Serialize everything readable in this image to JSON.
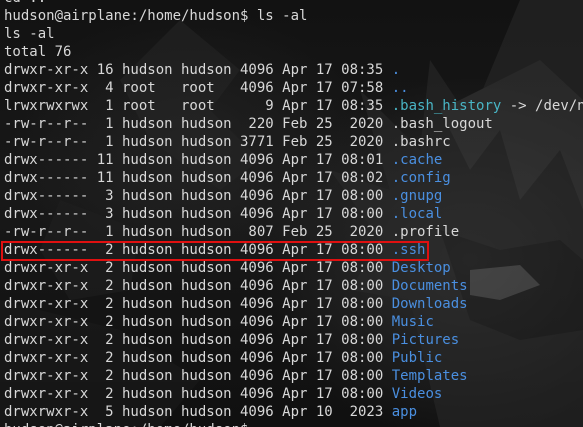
{
  "terminal": {
    "lines": [
      {
        "segments": [
          {
            "text": "cd ..",
            "style": "plain"
          }
        ]
      },
      {
        "segments": [
          {
            "text": "hudson@airplane:/home/hudson$ ls -al",
            "style": "plain"
          }
        ]
      },
      {
        "segments": [
          {
            "text": "ls -al",
            "style": "plain"
          }
        ]
      },
      {
        "segments": [
          {
            "text": "total 76",
            "style": "plain"
          }
        ]
      },
      {
        "segments": [
          {
            "text": "drwxr-xr-x 16 hudson hudson 4096 Apr 17 08:35 ",
            "style": "plain"
          },
          {
            "text": ".",
            "style": "dir"
          }
        ]
      },
      {
        "segments": [
          {
            "text": "drwxr-xr-x  4 root   root   4096 Apr 17 07:58 ",
            "style": "plain"
          },
          {
            "text": "..",
            "style": "dir"
          }
        ]
      },
      {
        "segments": [
          {
            "text": "lrwxrwxrwx  1 root   root      9 Apr 17 08:35 ",
            "style": "plain"
          },
          {
            "text": ".bash_history",
            "style": "cyan"
          },
          {
            "text": " -> /dev/null",
            "style": "plain"
          }
        ]
      },
      {
        "segments": [
          {
            "text": "-rw-r--r--  1 hudson hudson  220 Feb 25  2020 .bash_logout",
            "style": "plain"
          }
        ]
      },
      {
        "segments": [
          {
            "text": "-rw-r--r--  1 hudson hudson 3771 Feb 25  2020 .bashrc",
            "style": "plain"
          }
        ]
      },
      {
        "segments": [
          {
            "text": "drwx------ 11 hudson hudson 4096 Apr 17 08:01 ",
            "style": "plain"
          },
          {
            "text": ".cache",
            "style": "dir"
          }
        ]
      },
      {
        "segments": [
          {
            "text": "drwx------ 11 hudson hudson 4096 Apr 17 08:02 ",
            "style": "plain"
          },
          {
            "text": ".config",
            "style": "dir"
          }
        ]
      },
      {
        "segments": [
          {
            "text": "drwx------  3 hudson hudson 4096 Apr 17 08:00 ",
            "style": "plain"
          },
          {
            "text": ".gnupg",
            "style": "dir"
          }
        ]
      },
      {
        "segments": [
          {
            "text": "drwx------  3 hudson hudson 4096 Apr 17 08:00 ",
            "style": "plain"
          },
          {
            "text": ".local",
            "style": "dir"
          }
        ]
      },
      {
        "segments": [
          {
            "text": "-rw-r--r--  1 hudson hudson  807 Feb 25  2020 .profile",
            "style": "plain"
          }
        ]
      },
      {
        "segments": [
          {
            "text": "drwx------  2 hudson hudson 4096 Apr 17 08:00 ",
            "style": "plain"
          },
          {
            "text": ".ssh",
            "style": "dir"
          }
        ]
      },
      {
        "segments": [
          {
            "text": "drwxr-xr-x  2 hudson hudson 4096 Apr 17 08:00 ",
            "style": "plain"
          },
          {
            "text": "Desktop",
            "style": "dir"
          }
        ]
      },
      {
        "segments": [
          {
            "text": "drwxr-xr-x  2 hudson hudson 4096 Apr 17 08:00 ",
            "style": "plain"
          },
          {
            "text": "Documents",
            "style": "dir"
          }
        ]
      },
      {
        "segments": [
          {
            "text": "drwxr-xr-x  2 hudson hudson 4096 Apr 17 08:00 ",
            "style": "plain"
          },
          {
            "text": "Downloads",
            "style": "dir"
          }
        ]
      },
      {
        "segments": [
          {
            "text": "drwxr-xr-x  2 hudson hudson 4096 Apr 17 08:00 ",
            "style": "plain"
          },
          {
            "text": "Music",
            "style": "dir"
          }
        ]
      },
      {
        "segments": [
          {
            "text": "drwxr-xr-x  2 hudson hudson 4096 Apr 17 08:00 ",
            "style": "plain"
          },
          {
            "text": "Pictures",
            "style": "dir"
          }
        ]
      },
      {
        "segments": [
          {
            "text": "drwxr-xr-x  2 hudson hudson 4096 Apr 17 08:00 ",
            "style": "plain"
          },
          {
            "text": "Public",
            "style": "dir"
          }
        ]
      },
      {
        "segments": [
          {
            "text": "drwxr-xr-x  2 hudson hudson 4096 Apr 17 08:00 ",
            "style": "plain"
          },
          {
            "text": "Templates",
            "style": "dir"
          }
        ]
      },
      {
        "segments": [
          {
            "text": "drwxr-xr-x  2 hudson hudson 4096 Apr 17 08:00 ",
            "style": "plain"
          },
          {
            "text": "Videos",
            "style": "dir"
          }
        ]
      },
      {
        "segments": [
          {
            "text": "drwxrwxr-x  5 hudson hudson 4096 Apr 10  2023 ",
            "style": "plain"
          },
          {
            "text": "app",
            "style": "dir"
          }
        ]
      },
      {
        "segments": [
          {
            "text": "hudson@airplane:/home/hudson$ ",
            "style": "plain"
          }
        ]
      }
    ],
    "highlighted_row_index": 14,
    "highlight_color": "#e01010",
    "colors": {
      "background": "#121212",
      "text": "#d8d8d8",
      "directory": "#4a8fe0",
      "symlink": "#49b5c5"
    },
    "wallpaper": "dark-anime-character-wallpaper"
  }
}
